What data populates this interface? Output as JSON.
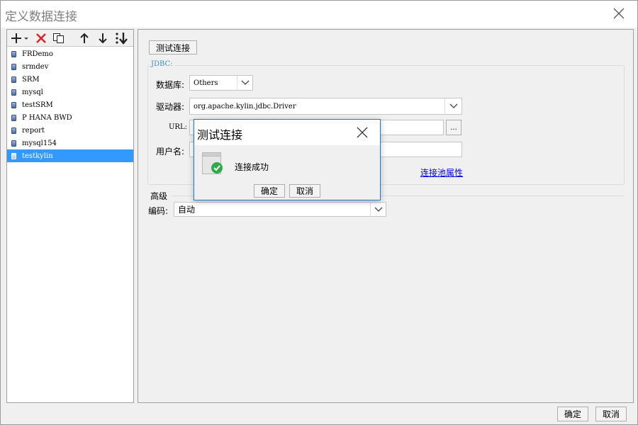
{
  "window": {
    "title": "定义数据连接"
  },
  "toolbar": {
    "icons": [
      "add-icon",
      "delete-icon",
      "copy-icon",
      "move-up-icon",
      "move-down-icon",
      "sort-icon"
    ]
  },
  "connections": [
    "FRDemo",
    "srmdev",
    "SRM",
    "mysql",
    "testSRM",
    "P HANA BWD",
    "report",
    "mysql154",
    "testkylin"
  ],
  "selected_connection": "testkylin",
  "right": {
    "test_button": "测试连接",
    "jdbc_legend": "JDBC:",
    "database_label": "数据库:",
    "database_value": "Others",
    "driver_label": "驱动器:",
    "driver_value": "org.apache.kylin.jdbc.Driver",
    "url_label": "URL:",
    "url_browse": "...",
    "username_label": "用户名:",
    "pool_link": "连接池属性",
    "advanced_label": "高级",
    "encoding_label": "编码:",
    "encoding_value": "自动"
  },
  "dialog": {
    "title": "测试连接",
    "message": "连接成功",
    "ok": "确定",
    "cancel": "取消"
  },
  "footer": {
    "ok": "确定",
    "cancel": "取消"
  },
  "colors": {
    "selection": "#3399ff",
    "success": "#2eaa48",
    "dialog_border": "#1979ca",
    "link": "#0000ee"
  }
}
